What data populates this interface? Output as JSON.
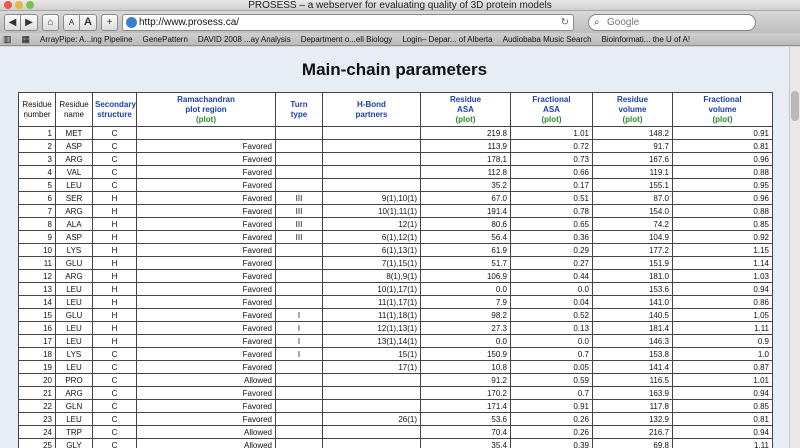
{
  "window": {
    "title": "PROSESS – a webserver for evaluating quality of 3D protein models"
  },
  "toolbar": {
    "back": "◀",
    "forward": "▶",
    "home": "⌂",
    "text_smaller": "A",
    "text_larger": "A",
    "add": "+",
    "url": "http://www.prosess.ca/",
    "search_placeholder": "Google"
  },
  "bookmarks": [
    "ArrayPipe: A...ing Pipeline",
    "GenePattern",
    "DAVID 2008 ...ay Analysis",
    "Department o...ell Biology",
    "Login– Depar... of Alberta",
    "Audiobaba Music Search",
    "Bioinformati... the U of A!"
  ],
  "page": {
    "title": "Main-chain parameters",
    "headers": {
      "num": [
        "Residue",
        "number"
      ],
      "name": [
        "Residue",
        "name"
      ],
      "ss": [
        "Secondary",
        "structure"
      ],
      "rama": [
        "Ramachandran",
        "plot region"
      ],
      "turn": [
        "Turn",
        "type"
      ],
      "hbond": [
        "H-Bond",
        "partners"
      ],
      "asa": [
        "Residue",
        "ASA"
      ],
      "frasa": [
        "Fractional",
        "ASA"
      ],
      "vol": [
        "Residue",
        "volume"
      ],
      "frvol": [
        "Fractional",
        "volume"
      ],
      "plot": "(plot)"
    },
    "rows": [
      {
        "n": "1",
        "name": "MET",
        "ss": "C",
        "rama": "",
        "turn": "",
        "hb": "",
        "asa": "219.8",
        "fasa": "1.01",
        "vol": "148.2",
        "fvol": "0.91"
      },
      {
        "n": "2",
        "name": "ASP",
        "ss": "C",
        "rama": "Favored",
        "turn": "",
        "hb": "",
        "asa": "113.9",
        "fasa": "0.72",
        "vol": "91.7",
        "fvol": "0.81"
      },
      {
        "n": "3",
        "name": "ARG",
        "ss": "C",
        "rama": "Favored",
        "turn": "",
        "hb": "",
        "asa": "178.1",
        "fasa": "0.73",
        "vol": "167.6",
        "fvol": "0.96"
      },
      {
        "n": "4",
        "name": "VAL",
        "ss": "C",
        "rama": "Favored",
        "turn": "",
        "hb": "",
        "asa": "112.8",
        "fasa": "0.66",
        "vol": "119.1",
        "fvol": "0.88"
      },
      {
        "n": "5",
        "name": "LEU",
        "ss": "C",
        "rama": "Favored",
        "turn": "",
        "hb": "",
        "asa": "35.2",
        "fasa": "0.17",
        "vol": "155.1",
        "fvol": "0.95"
      },
      {
        "n": "6",
        "name": "SER",
        "ss": "H",
        "rama": "Favored",
        "turn": "III",
        "hb": "9(1),10(1)",
        "asa": "67.0",
        "fasa": "0.51",
        "vol": "87.0",
        "fvol": "0.96"
      },
      {
        "n": "7",
        "name": "ARG",
        "ss": "H",
        "rama": "Favored",
        "turn": "III",
        "hb": "10(1),11(1)",
        "asa": "191.4",
        "fasa": "0.78",
        "vol": "154.0",
        "fvol": "0.88"
      },
      {
        "n": "8",
        "name": "ALA",
        "ss": "H",
        "rama": "Favored",
        "turn": "III",
        "hb": "12(1)",
        "asa": "80.6",
        "fasa": "0.65",
        "vol": "74.2",
        "fvol": "0.85"
      },
      {
        "n": "9",
        "name": "ASP",
        "ss": "H",
        "rama": "Favored",
        "turn": "III",
        "hb": "6(1),12(1)",
        "asa": "56.4",
        "fasa": "0.36",
        "vol": "104.9",
        "fvol": "0.92"
      },
      {
        "n": "10",
        "name": "LYS",
        "ss": "H",
        "rama": "Favored",
        "turn": "",
        "hb": "6(1),13(1)",
        "asa": "61.9",
        "fasa": "0.29",
        "vol": "177.2",
        "fvol": "1.15"
      },
      {
        "n": "11",
        "name": "GLU",
        "ss": "H",
        "rama": "Favored",
        "turn": "",
        "hb": "7(1),15(1)",
        "asa": "51.7",
        "fasa": "0.27",
        "vol": "151.9",
        "fvol": "1.14"
      },
      {
        "n": "12",
        "name": "ARG",
        "ss": "H",
        "rama": "Favored",
        "turn": "",
        "hb": "8(1),9(1)",
        "asa": "106.9",
        "fasa": "0.44",
        "vol": "181.0",
        "fvol": "1.03"
      },
      {
        "n": "13",
        "name": "LEU",
        "ss": "H",
        "rama": "Favored",
        "turn": "",
        "hb": "10(1),17(1)",
        "asa": "0.0",
        "fasa": "0.0",
        "vol": "153.6",
        "fvol": "0.94"
      },
      {
        "n": "14",
        "name": "LEU",
        "ss": "H",
        "rama": "Favored",
        "turn": "",
        "hb": "11(1),17(1)",
        "asa": "7.9",
        "fasa": "0.04",
        "vol": "141.0",
        "fvol": "0.86"
      },
      {
        "n": "15",
        "name": "GLU",
        "ss": "H",
        "rama": "Favored",
        "turn": "I",
        "hb": "11(1),18(1)",
        "asa": "98.2",
        "fasa": "0.52",
        "vol": "140.5",
        "fvol": "1.05"
      },
      {
        "n": "16",
        "name": "LEU",
        "ss": "H",
        "rama": "Favored",
        "turn": "I",
        "hb": "12(1),13(1)",
        "asa": "27.3",
        "fasa": "0.13",
        "vol": "181.4",
        "fvol": "1.11"
      },
      {
        "n": "17",
        "name": "LEU",
        "ss": "H",
        "rama": "Favored",
        "turn": "I",
        "hb": "13(1),14(1)",
        "asa": "0.0",
        "fasa": "0.0",
        "vol": "146.3",
        "fvol": "0.9"
      },
      {
        "n": "18",
        "name": "LYS",
        "ss": "C",
        "rama": "Favored",
        "turn": "I",
        "hb": "15(1)",
        "asa": "150.9",
        "fasa": "0.7",
        "vol": "153.8",
        "fvol": "1.0"
      },
      {
        "n": "19",
        "name": "LEU",
        "ss": "C",
        "rama": "Favored",
        "turn": "",
        "hb": "17(1)",
        "asa": "10.8",
        "fasa": "0.05",
        "vol": "141.4",
        "fvol": "0.87"
      },
      {
        "n": "20",
        "name": "PRO",
        "ss": "C",
        "rama": "Allowed",
        "turn": "",
        "hb": "",
        "asa": "91.2",
        "fasa": "0.59",
        "vol": "116.5",
        "fvol": "1.01"
      },
      {
        "n": "21",
        "name": "ARG",
        "ss": "C",
        "rama": "Favored",
        "turn": "",
        "hb": "",
        "asa": "170.2",
        "fasa": "0.7",
        "vol": "163.9",
        "fvol": "0.94"
      },
      {
        "n": "22",
        "name": "GLN",
        "ss": "C",
        "rama": "Favored",
        "turn": "",
        "hb": "",
        "asa": "171.4",
        "fasa": "0.91",
        "vol": "117.8",
        "fvol": "0.85"
      },
      {
        "n": "23",
        "name": "LEU",
        "ss": "C",
        "rama": "Favored",
        "turn": "",
        "hb": "26(1)",
        "asa": "53.6",
        "fasa": "0.26",
        "vol": "132.9",
        "fvol": "0.81"
      },
      {
        "n": "24",
        "name": "TRP",
        "ss": "C",
        "rama": "Allowed",
        "turn": "",
        "hb": "",
        "asa": "70.4",
        "fasa": "0.26",
        "vol": "216.7",
        "fvol": "0.94"
      },
      {
        "n": "25",
        "name": "GLY",
        "ss": "C",
        "rama": "Allowed",
        "turn": "",
        "hb": "",
        "asa": "35.4",
        "fasa": "0.39",
        "vol": "69.8",
        "fvol": "1.11"
      }
    ]
  }
}
